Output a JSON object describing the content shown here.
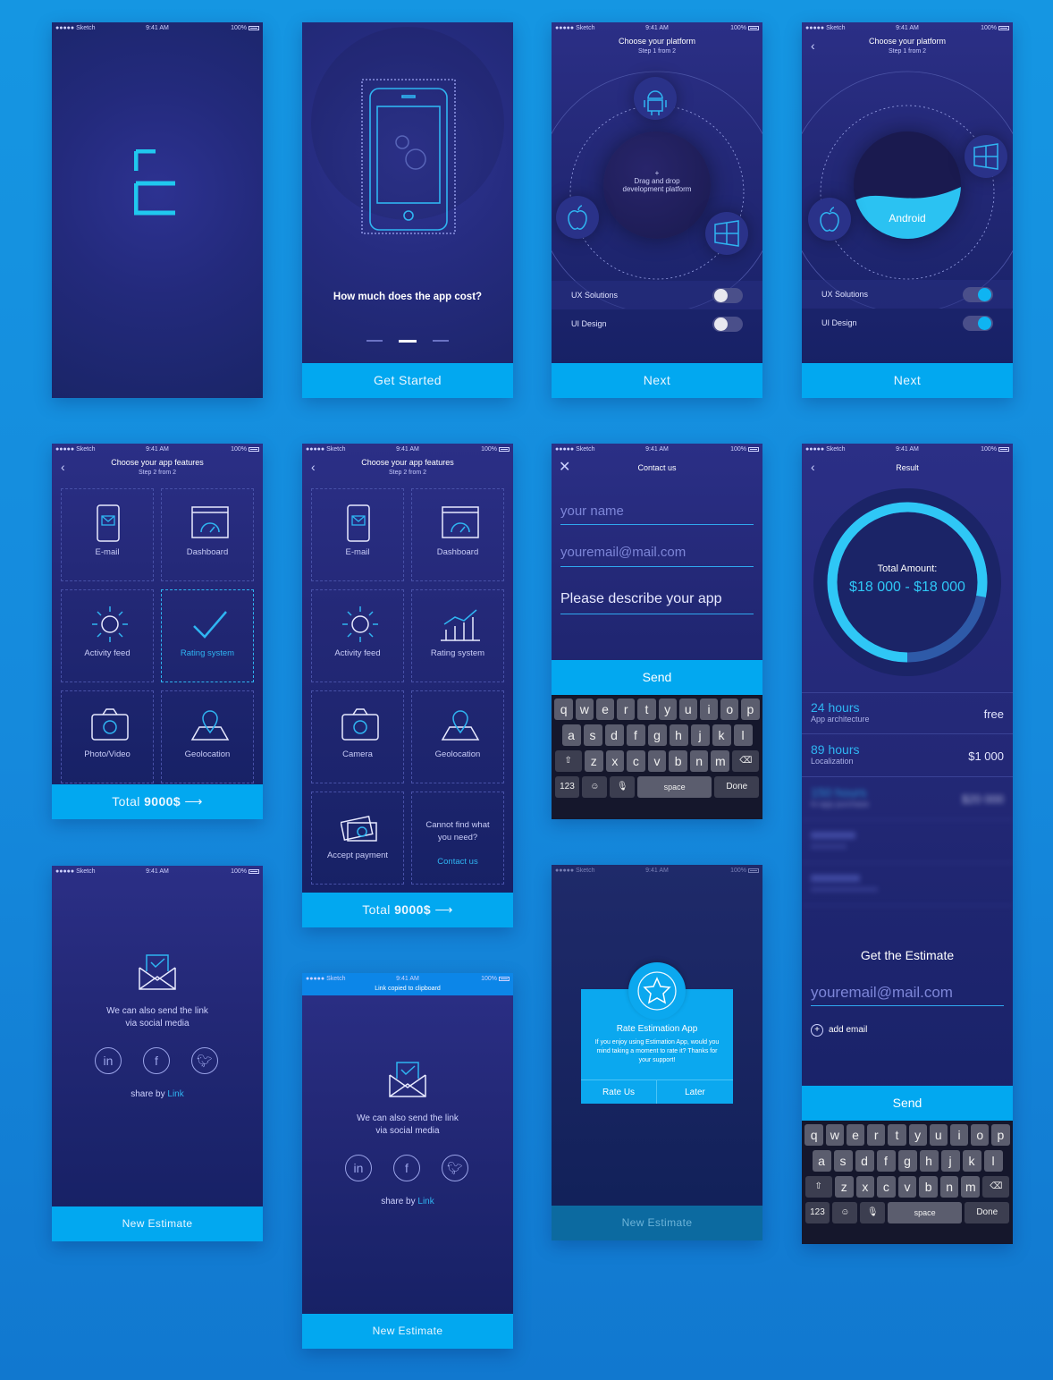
{
  "status": {
    "carrier": "●●●●● Sketch",
    "time": "9:41 AM",
    "battery": "100%",
    "clipboard": "Link copied to clipboard"
  },
  "onboarding": {
    "question": "How much does the app cost?",
    "button": "Get Started"
  },
  "platform": {
    "title": "Choose your platform",
    "step": "Step 1 from 2",
    "plus": "+",
    "drag": "Drag and drop development platform",
    "selected": "Android",
    "opt1": "UX Solutions",
    "opt2": "UI Design",
    "button": "Next"
  },
  "features": {
    "title": "Choose your app features",
    "step": "Step 2 from 2",
    "items1": [
      "E-mail",
      "Dashboard",
      "Activity feed",
      "Rating system",
      "Photo/Video",
      "Geolocation"
    ],
    "items2": [
      "E-mail",
      "Dashboard",
      "Activity feed",
      "Rating system",
      "Camera",
      "Geolocation",
      "Accept payment"
    ],
    "cannot": "Cannot find what you need?",
    "contact": "Contact us",
    "total_label": "Total",
    "total_value": "9000$"
  },
  "contact": {
    "title": "Contact us",
    "name": "your name",
    "email": "youremail@mail.com",
    "describe": "Please describe your app",
    "send": "Send"
  },
  "keyboard": {
    "row1": [
      "q",
      "w",
      "e",
      "r",
      "t",
      "y",
      "u",
      "i",
      "o",
      "p"
    ],
    "row2": [
      "a",
      "s",
      "d",
      "f",
      "g",
      "h",
      "j",
      "k",
      "l"
    ],
    "row3": [
      "z",
      "x",
      "c",
      "v",
      "b",
      "n",
      "m"
    ],
    "num": "123",
    "space": "space",
    "done": "Done"
  },
  "result": {
    "title": "Result",
    "total_label": "Total Amount:",
    "total_value": "$18 000 - $18 000",
    "ring_fraction": 0.78,
    "rows": [
      {
        "h": "24 hours",
        "s": "App architecture",
        "p": "free"
      },
      {
        "h": "89 hours",
        "s": "Localization",
        "p": "$1 000"
      },
      {
        "h": "150 hours",
        "s": "In-app purchase",
        "p": "$20 000"
      }
    ],
    "estimate": "Get the Estimate",
    "email": "youremail@mail.com",
    "add": "add email",
    "send": "Send"
  },
  "share": {
    "line1": "We can also send the link",
    "line2": "via social media",
    "share_by": "share by",
    "link": "Link",
    "button": "New Estimate"
  },
  "rate": {
    "title": "Rate Estimation App",
    "text": "If you enjoy using Estimation App, would you mind taking a moment to rate it? Thanks for your support!",
    "rate": "Rate Us",
    "later": "Later",
    "button": "New Estimate"
  },
  "colors": {
    "accent": "#02a8f0",
    "bg": "#232876"
  }
}
